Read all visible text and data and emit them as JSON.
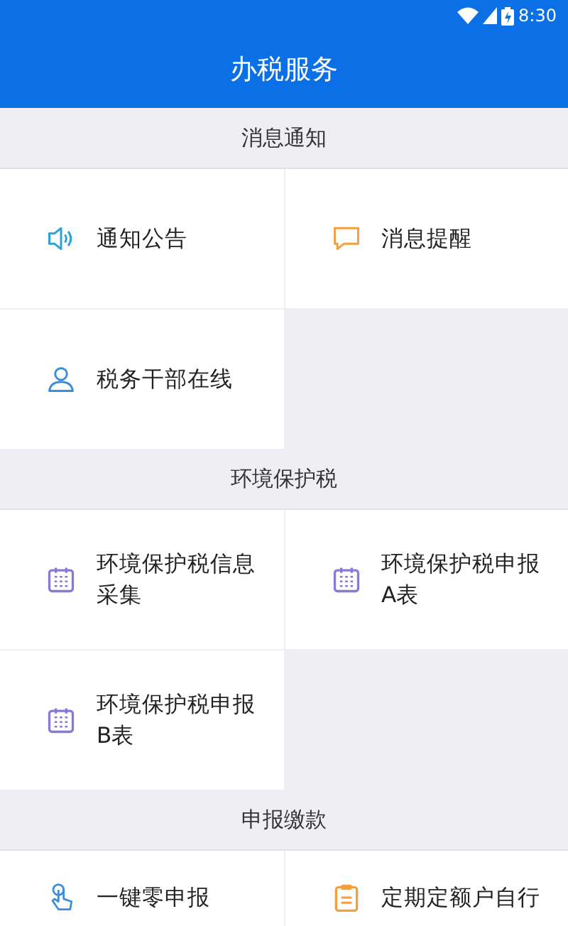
{
  "status_bar": {
    "time": "8:30"
  },
  "title": "办税服务",
  "sections": [
    {
      "title": "消息通知",
      "items": [
        {
          "label": "通知公告",
          "kind": "speaker"
        },
        {
          "label": "消息提醒",
          "kind": "chat"
        },
        {
          "label": "税务干部在线",
          "kind": "person"
        }
      ]
    },
    {
      "title": "环境保护税",
      "items": [
        {
          "label": "环境保护税信息采集",
          "kind": "calendar"
        },
        {
          "label": "环境保护税申报A表",
          "kind": "calendar"
        },
        {
          "label": "环境保护税申报B表",
          "kind": "calendar"
        }
      ]
    },
    {
      "title": "申报缴款",
      "items": [
        {
          "label": "一键零申报",
          "kind": "hand"
        },
        {
          "label": "定期定额户自行",
          "kind": "clipboard"
        }
      ]
    }
  ]
}
